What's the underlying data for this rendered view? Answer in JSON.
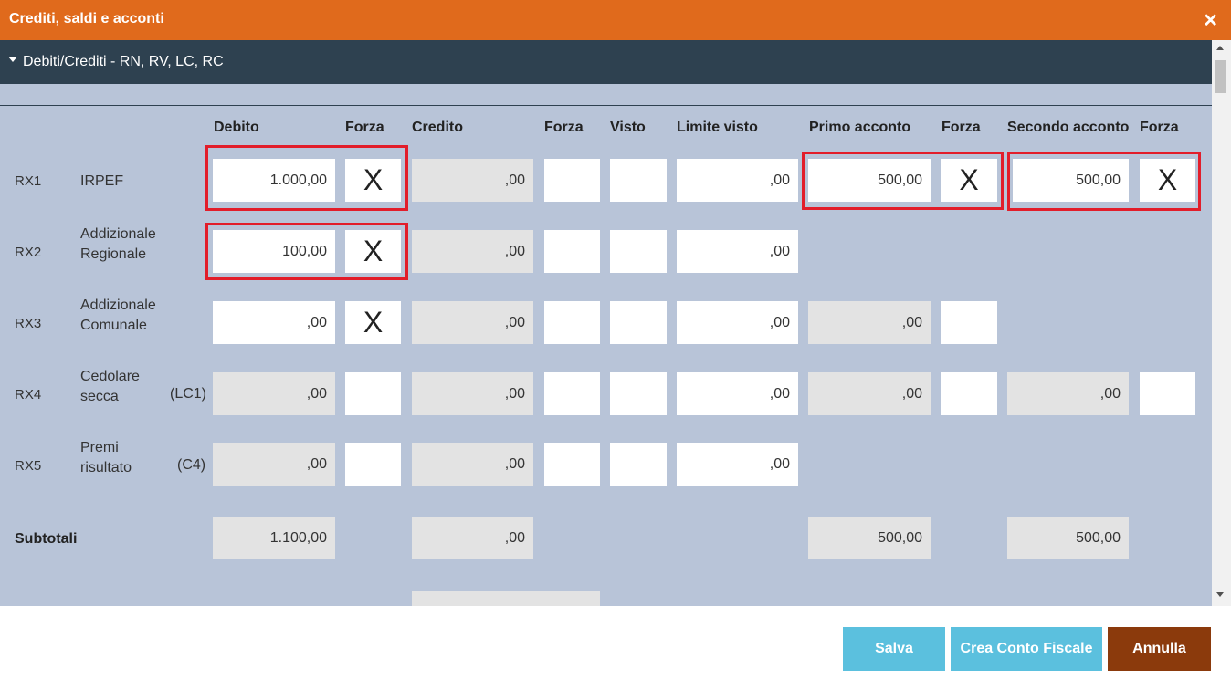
{
  "window": {
    "title": "Crediti, saldi e acconti",
    "close_glyph": "✕"
  },
  "section": {
    "title": "Debiti/Crediti - RN, RV, LC, RC"
  },
  "headers": {
    "debito": "Debito",
    "forza_debito": "Forza",
    "credito": "Credito",
    "forza_credito": "Forza",
    "visto": "Visto",
    "limite_visto": "Limite visto",
    "primo_acconto": "Primo acconto",
    "forza_primo": "Forza",
    "secondo_acconto": "Secondo acconto",
    "forza_secondo": "Forza"
  },
  "rows": [
    {
      "code": "RX1",
      "name": "IRPEF",
      "sub": "",
      "debito": "1.000,00",
      "forza_debito": "X",
      "credito": ",00",
      "forza_credito": "",
      "visto": "",
      "limite_visto": ",00",
      "primo_acconto": "500,00",
      "forza_primo": "X",
      "secondo_acconto": "500,00",
      "forza_secondo": "X"
    },
    {
      "code": "RX2",
      "name": "Addizionale Regionale",
      "sub": "",
      "debito": "100,00",
      "forza_debito": "X",
      "credito": ",00",
      "forza_credito": "",
      "visto": "",
      "limite_visto": ",00"
    },
    {
      "code": "RX3",
      "name": "Addizionale Comunale",
      "sub": "",
      "debito": ",00",
      "forza_debito": "X",
      "credito": ",00",
      "forza_credito": "",
      "visto": "",
      "limite_visto": ",00",
      "primo_acconto": ",00",
      "forza_primo": ""
    },
    {
      "code": "RX4",
      "name": "Cedolare secca",
      "sub": "(LC1)",
      "debito": ",00",
      "forza_debito": "",
      "credito": ",00",
      "forza_credito": "",
      "visto": "",
      "limite_visto": ",00",
      "primo_acconto": ",00",
      "forza_primo": "",
      "secondo_acconto": ",00",
      "forza_secondo": ""
    },
    {
      "code": "RX5",
      "name": "Premi risultato",
      "sub": "(C4)",
      "debito": ",00",
      "forza_debito": "",
      "credito": ",00",
      "forza_credito": "",
      "visto": "",
      "limite_visto": ",00"
    }
  ],
  "subtotali": {
    "label": "Subtotali",
    "debito": "1.100,00",
    "credito": ",00",
    "primo_acconto": "500,00",
    "secondo_acconto": "500,00"
  },
  "buttons": {
    "salva": "Salva",
    "crea_conto_fiscale": "Crea Conto Fiscale",
    "annulla": "Annulla"
  },
  "colors": {
    "title_bar": "#e06a1c",
    "section_bar": "#2e4150",
    "panel_bg": "#b8c4d8",
    "highlight": "#e21d2a",
    "btn_blue": "#5bc0de",
    "btn_brown": "#8b3a0c"
  }
}
